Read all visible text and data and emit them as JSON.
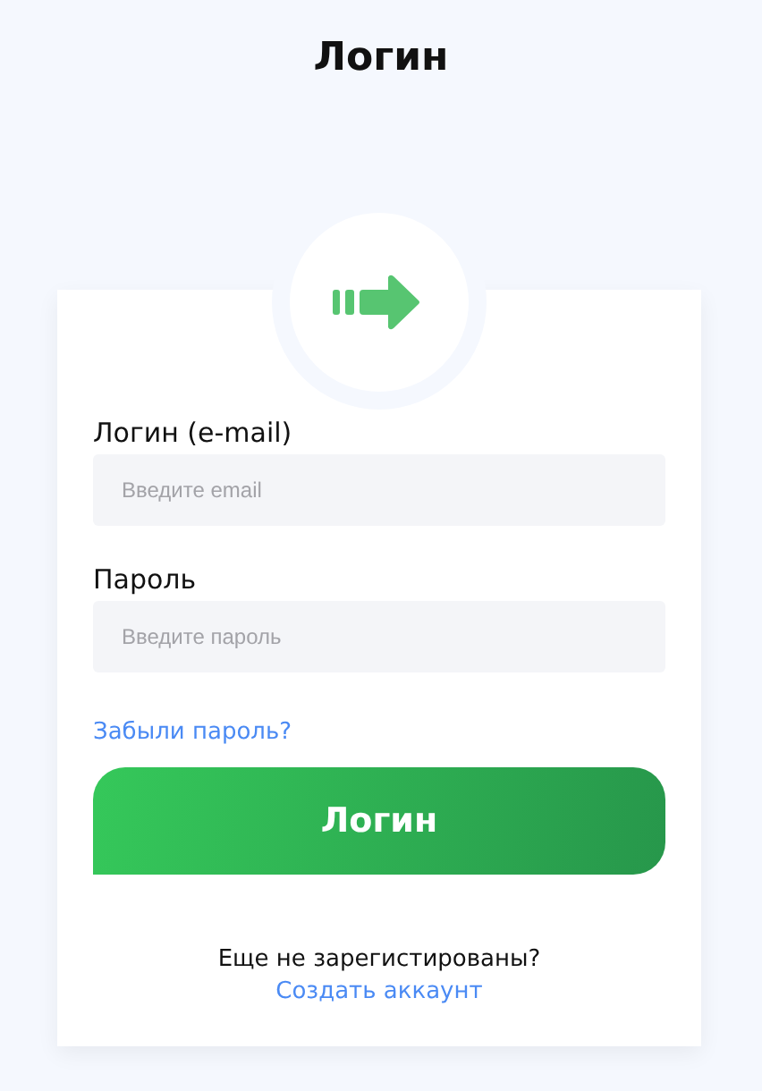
{
  "title": "Логин",
  "fields": [
    {
      "label": "Логин (e-mail)",
      "placeholder": "Введите email"
    },
    {
      "label": "Пароль",
      "placeholder": "Введите пароль"
    }
  ],
  "forgot_link": "Забыли пароль?",
  "submit_button": "Логин",
  "signup_prompt": "Еще не зарегистированы?",
  "signup_link": "Создать аккаунт"
}
